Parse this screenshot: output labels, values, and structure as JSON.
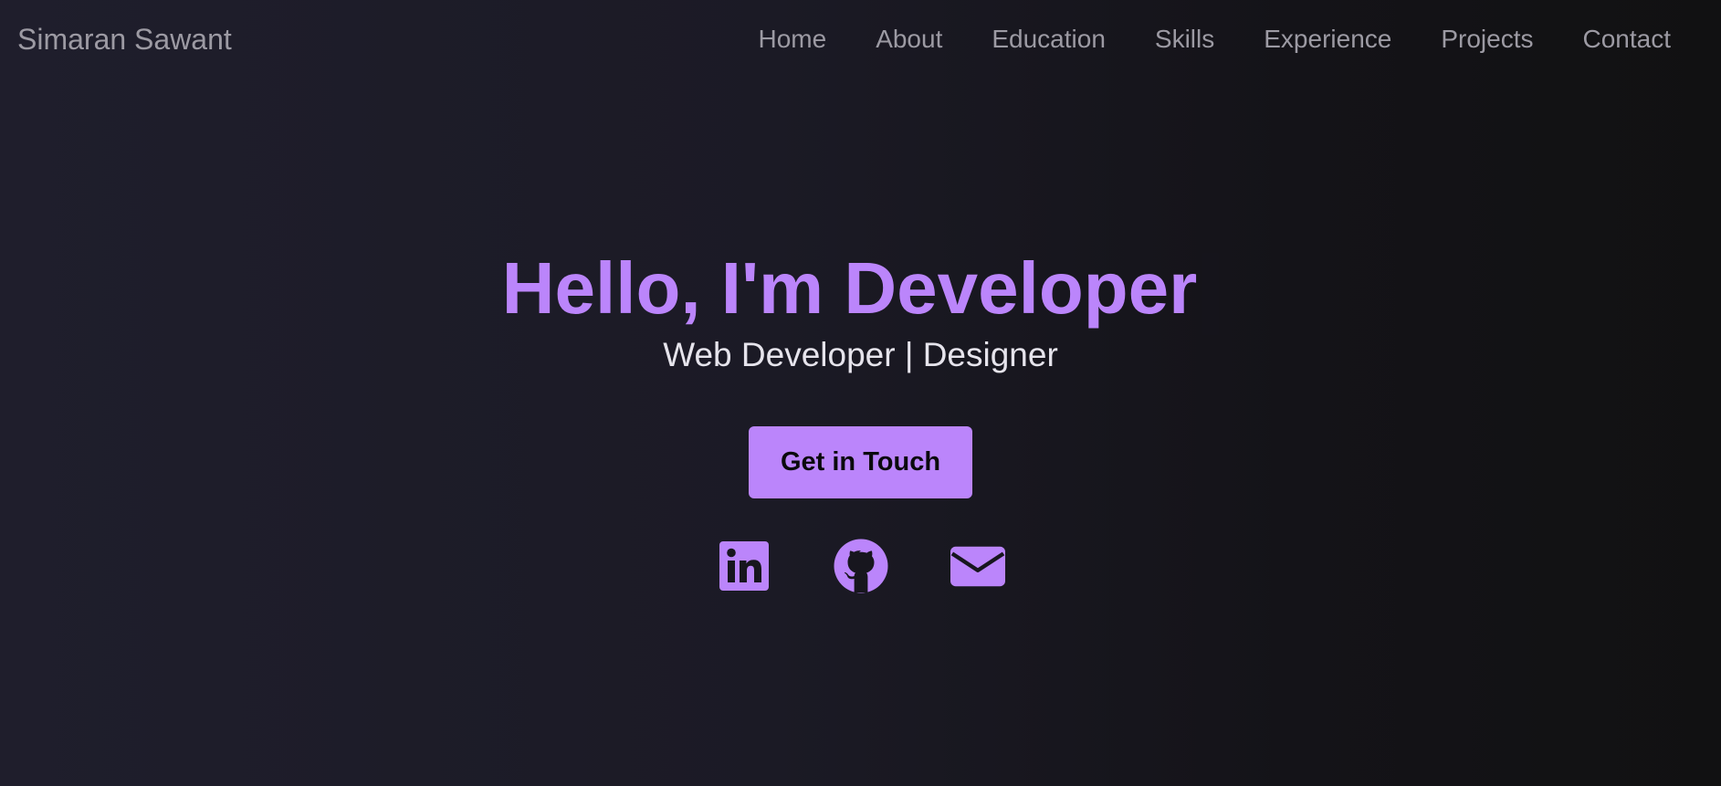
{
  "brand": "Simaran Sawant",
  "nav": {
    "items": [
      {
        "label": "Home"
      },
      {
        "label": "About"
      },
      {
        "label": "Education"
      },
      {
        "label": "Skills"
      },
      {
        "label": "Experience"
      },
      {
        "label": "Projects"
      },
      {
        "label": "Contact"
      }
    ]
  },
  "hero": {
    "title": "Hello, I'm Developer",
    "subtitle": "Web Developer | Designer",
    "cta_label": "Get in Touch"
  },
  "socials": [
    {
      "icon": "linkedin-icon"
    },
    {
      "icon": "github-icon"
    },
    {
      "icon": "mail-icon"
    }
  ],
  "colors": {
    "accent": "#bb85fb",
    "nav_text": "#9c9aa3",
    "subtitle_text": "#e6e4ec",
    "background": "#1b1a25"
  }
}
